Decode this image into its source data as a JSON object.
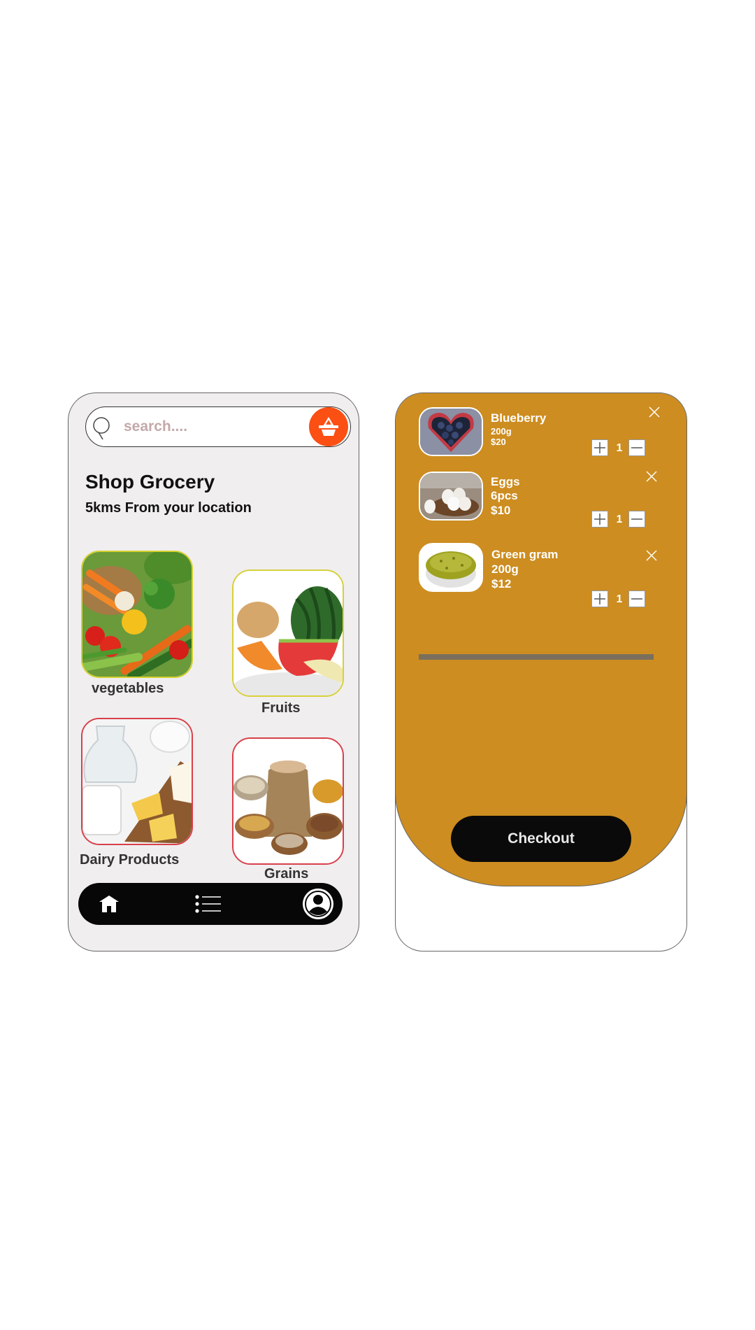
{
  "home": {
    "search": {
      "placeholder": "search...."
    },
    "title": "Shop Grocery",
    "subtitle": "5kms From your location",
    "categories": [
      {
        "label": "vegetables"
      },
      {
        "label": "Fruits"
      },
      {
        "label": "Dairy Products"
      },
      {
        "label": "Grains"
      }
    ],
    "nav": [
      "home-icon",
      "list-icon",
      "profile-icon"
    ]
  },
  "cart": {
    "items": [
      {
        "name": "Blueberry",
        "size": "200g",
        "price": "$20",
        "qty": "1"
      },
      {
        "name": "Eggs",
        "size": "6pcs",
        "price": "$10",
        "qty": "1"
      },
      {
        "name": "Green gram",
        "size": "200g",
        "price": "$12",
        "qty": "1"
      }
    ],
    "checkout_label": "Checkout"
  },
  "colors": {
    "accent_orange": "#fb4f14",
    "cart_background": "#cd8d20",
    "nav_background": "#070707",
    "phone_background": "#f0eeef"
  }
}
